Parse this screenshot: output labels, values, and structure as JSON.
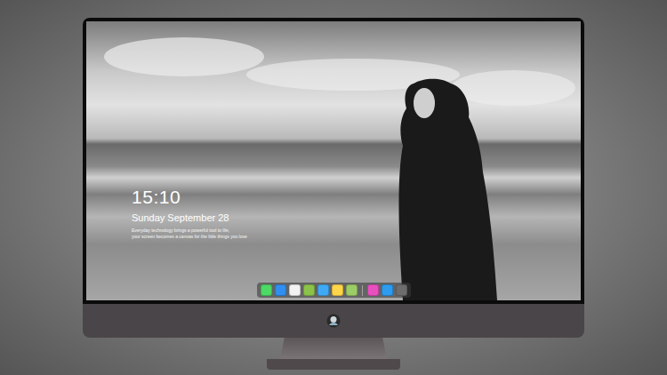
{
  "lock_screen": {
    "time": "15:10",
    "date": "Sunday September 28",
    "caption": [
      "Everyday technology brings a powerful tool to life,",
      "your screen becomes a canvas for the little things you love"
    ]
  },
  "dock": {
    "apps": [
      {
        "color": "#4cd964",
        "group": 1
      },
      {
        "color": "#2f8ff0",
        "group": 1
      },
      {
        "color": "#f2f2f2",
        "group": 1
      },
      {
        "color": "#8bc34a",
        "group": 1
      },
      {
        "color": "#3fa9f5",
        "group": 1
      },
      {
        "color": "#ffd54a",
        "group": 1
      },
      {
        "color": "#9ccc65",
        "group": 1
      },
      {
        "color": "#e84fbf",
        "group": 2
      },
      {
        "color": "#2d9cf0",
        "group": 2
      },
      {
        "color": "#6d6d6d",
        "group": 2
      }
    ]
  }
}
